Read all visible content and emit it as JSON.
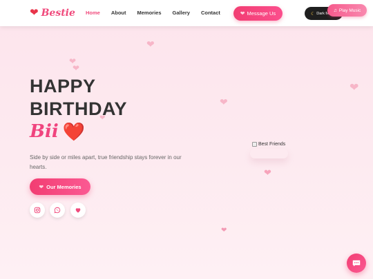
{
  "logo": {
    "text": "Bestie",
    "icon": "heart-icon"
  },
  "nav": {
    "items": [
      "Home",
      "About",
      "Memories",
      "Gallery",
      "Contact"
    ],
    "active": "Home"
  },
  "header_buttons": {
    "message": "Message Us",
    "dark_mode": "Dark Mode",
    "music": "Play Music"
  },
  "hero": {
    "title_line_1": "HAPPY",
    "title_line_2": "BIRTHDAY",
    "name": "Bii",
    "name_emoji": "❤️",
    "description": "Side by side or miles apart, true friendship stays forever in our hearts.",
    "cta": "Our Memories"
  },
  "social": [
    "instagram-icon",
    "whatsapp-icon",
    "heart-icon"
  ],
  "image": {
    "alt": "Best Friends"
  },
  "colors": {
    "accent": "#f04a7c",
    "dark": "#1f1f1f",
    "background": "#fde4ec"
  }
}
